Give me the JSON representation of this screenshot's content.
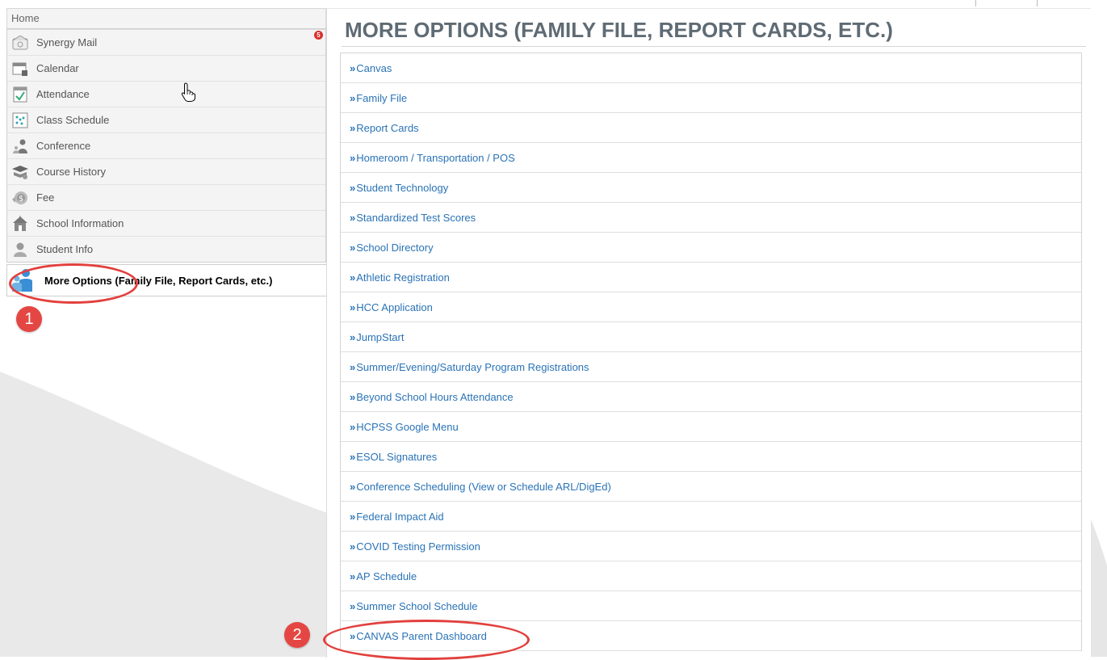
{
  "sidebar": {
    "home_label": "Home",
    "items": [
      {
        "label": "Synergy Mail",
        "icon": "mail-icon",
        "badge": "5"
      },
      {
        "label": "Calendar",
        "icon": "calendar-icon"
      },
      {
        "label": "Attendance",
        "icon": "attendance-icon"
      },
      {
        "label": "Class Schedule",
        "icon": "class-schedule-icon"
      },
      {
        "label": "Conference",
        "icon": "conference-icon"
      },
      {
        "label": "Course History",
        "icon": "course-history-icon"
      },
      {
        "label": "Fee",
        "icon": "fee-icon"
      },
      {
        "label": "School Information",
        "icon": "school-icon"
      },
      {
        "label": "Student Info",
        "icon": "student-icon"
      }
    ],
    "active_item": {
      "label": "More Options (Family File, Report Cards, etc.)",
      "icon": "more-options-icon"
    }
  },
  "main": {
    "title": "MORE OPTIONS (FAMILY FILE, REPORT CARDS, ETC.)",
    "arrow_glyph": "»",
    "options": [
      "Canvas",
      "Family File",
      "Report Cards",
      "Homeroom / Transportation / POS",
      "Student Technology",
      "Standardized Test Scores",
      "School Directory",
      "Athletic Registration",
      "HCC Application",
      "JumpStart",
      "Summer/Evening/Saturday Program Registrations",
      "Beyond School Hours Attendance",
      "HCPSS Google Menu",
      "ESOL Signatures",
      "Conference Scheduling (View or Schedule ARL/DigEd)",
      "Federal Impact Aid",
      "COVID Testing Permission",
      "AP Schedule",
      "Summer School Schedule",
      "CANVAS Parent Dashboard"
    ]
  },
  "annotations": {
    "step1": "1",
    "step2": "2"
  },
  "colors": {
    "link": "#2a73b6",
    "annotation": "#e2403d",
    "title": "#5f6b74",
    "badge": "#d9302c"
  }
}
